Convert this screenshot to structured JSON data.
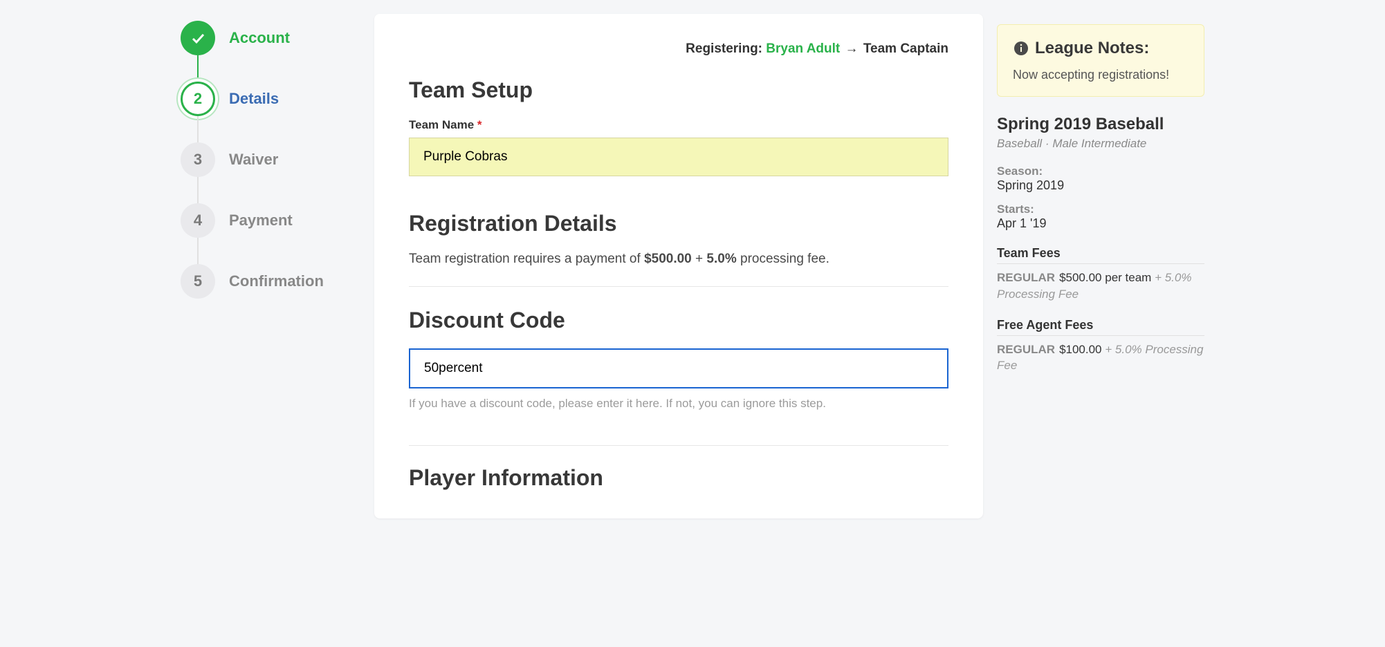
{
  "steps": [
    {
      "label": "Account",
      "state": "completed"
    },
    {
      "label": "Details",
      "state": "active",
      "num": "2"
    },
    {
      "label": "Waiver",
      "state": "pending",
      "num": "3"
    },
    {
      "label": "Payment",
      "state": "pending",
      "num": "4"
    },
    {
      "label": "Confirmation",
      "state": "pending",
      "num": "5"
    }
  ],
  "header": {
    "registering_prefix": "Registering: ",
    "user": "Bryan Adult",
    "role": "Team Captain",
    "arrow": "→"
  },
  "team_setup": {
    "title": "Team Setup",
    "name_label": "Team Name",
    "required": "*",
    "name_value": "Purple Cobras"
  },
  "reg_details": {
    "title": "Registration Details",
    "text_prefix": "Team registration requires a payment of ",
    "amount": "$500.00",
    "plus": " + ",
    "fee": "5.0%",
    "text_suffix": " processing fee."
  },
  "discount": {
    "title": "Discount Code",
    "value": "50percent",
    "help": "If you have a discount code, please enter it here. If not, you can ignore this step."
  },
  "player_info": {
    "title": "Player Information"
  },
  "notes": {
    "title": "League Notes:",
    "body": "Now accepting registrations!"
  },
  "league": {
    "title": "Spring 2019 Baseball",
    "subtitle": "Baseball · Male Intermediate",
    "season_label": "Season:",
    "season_value": "Spring 2019",
    "starts_label": "Starts:",
    "starts_value": "Apr 1 '19"
  },
  "team_fees": {
    "heading": "Team Fees",
    "tag": "REGULAR",
    "price": "$500.00 per team",
    "extra": "+ 5.0% Processing Fee"
  },
  "agent_fees": {
    "heading": "Free Agent Fees",
    "tag": "REGULAR",
    "price": "$100.00",
    "extra": "+ 5.0% Processing Fee"
  }
}
